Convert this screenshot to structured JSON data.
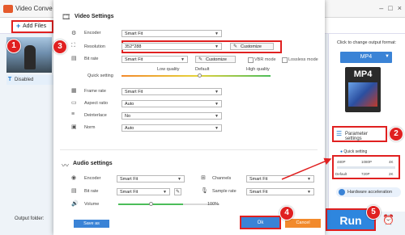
{
  "app": {
    "title": "Video Conve",
    "disabled_label": "Disabled",
    "output_folder_label": "Output folder:"
  },
  "toolbar": {
    "add_files_label": "Add Files"
  },
  "dialog": {
    "video_title": "Video Settings",
    "audio_title": "Audio settings",
    "encoder": {
      "label": "Encoder",
      "value": "Smart Fit"
    },
    "resolution": {
      "label": "Resolution",
      "value": "352*288",
      "customize": "Customize"
    },
    "bitrate": {
      "label": "Bit rate",
      "value": "Smart Fit",
      "customize": "Customize",
      "vbr": "VBR mode",
      "lossless": "Lossless mode"
    },
    "quick_setting": {
      "label": "Quick setting",
      "low": "Low quality",
      "default": "Default",
      "high": "High quality"
    },
    "frame_rate": {
      "label": "Frame rate",
      "value": "Smart Fit"
    },
    "aspect_ratio": {
      "label": "Aspect ratio",
      "value": "Auto"
    },
    "deinterlace": {
      "label": "Deinterlace",
      "value": "No"
    },
    "norm": {
      "label": "Norm",
      "value": "Auto"
    },
    "audio": {
      "encoder": {
        "label": "Encoder",
        "value": "Smart Fit"
      },
      "bitrate": {
        "label": "Bit rate",
        "value": "Smart Fit"
      },
      "volume": {
        "label": "Volume",
        "value": "100%"
      },
      "channels": {
        "label": "Channels",
        "value": "Smart Fit"
      },
      "sample_rate": {
        "label": "Sample rate",
        "value": "Smart Fit"
      }
    },
    "save_as": "Save as",
    "ok": "Ok",
    "cancel": "Cancel"
  },
  "right_panel": {
    "click_change": "Click to change output format:",
    "format": "MP4",
    "format_icon_text": "MP4",
    "parameter_settings": "Parameter settings",
    "quick_setting": "Quick setting",
    "q_top": [
      "480P",
      "1080P",
      "4K"
    ],
    "q_bottom": [
      "Default",
      "720P",
      "2K"
    ],
    "hw_accel": "Hardware acceleration"
  },
  "run_label": "Run",
  "markers": [
    "1",
    "2",
    "3",
    "4",
    "5"
  ],
  "colors": {
    "accent": "#3a83d6",
    "highlight": "#e02020",
    "cancel": "#f28a2c"
  }
}
